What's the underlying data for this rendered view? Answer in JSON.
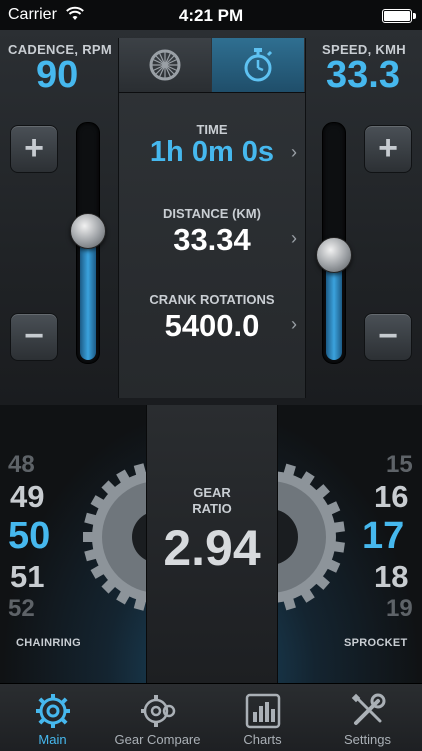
{
  "status_bar": {
    "carrier": "Carrier",
    "time": "4:21 PM"
  },
  "cadence": {
    "label": "CADENCE, RPM",
    "value": "90",
    "level": 0.55
  },
  "speed": {
    "label": "SPEED, KMH",
    "value": "33.3",
    "level": 0.45
  },
  "stats": {
    "time": {
      "label": "TIME",
      "value": "1h 0m 0s"
    },
    "distance": {
      "label": "DISTANCE (KM)",
      "value": "33.34"
    },
    "crank": {
      "label": "CRANK ROTATIONS",
      "value": "5400.0"
    }
  },
  "chainring": {
    "label": "CHAINRING",
    "numbers": [
      "48",
      "49",
      "50",
      "51",
      "52"
    ],
    "selected": "50"
  },
  "sprocket": {
    "label": "SPROCKET",
    "numbers": [
      "15",
      "16",
      "17",
      "18",
      "19"
    ],
    "selected": "17"
  },
  "gear_ratio": {
    "label_line1": "GEAR",
    "label_line2": "RATIO",
    "value": "2.94"
  },
  "tabbar": {
    "items": [
      {
        "label": "Main",
        "icon": "gear-icon",
        "active": true
      },
      {
        "label": "Gear Compare",
        "icon": "gear-compare-icon",
        "active": false
      },
      {
        "label": "Charts",
        "icon": "chart-icon",
        "active": false
      },
      {
        "label": "Settings",
        "icon": "wrench-screwdriver-icon",
        "active": false
      }
    ]
  },
  "colors": {
    "accent": "#46b8ee",
    "background": "#111315"
  },
  "icons": {
    "mode_left": "bike-wheel-icon",
    "mode_right": "stopwatch-icon"
  }
}
